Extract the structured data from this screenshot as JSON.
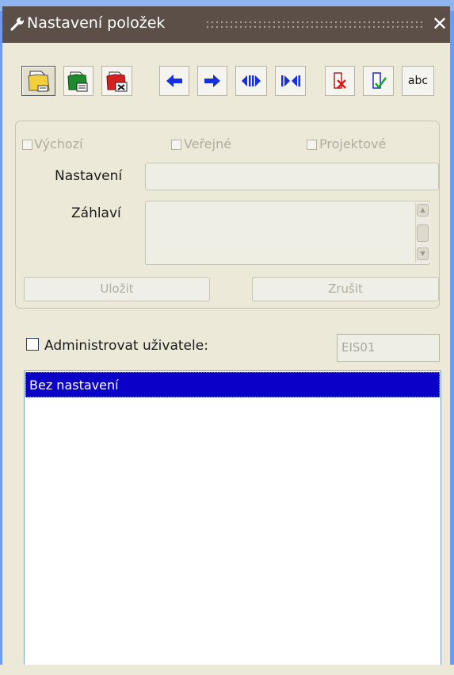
{
  "window": {
    "title": "Nastavení položek",
    "close_glyph": "✕"
  },
  "toolbar": {
    "buttons": [
      {
        "name": "new-setting-button",
        "icon": "folder-new-icon"
      },
      {
        "name": "copy-setting-button",
        "icon": "folder-copy-icon"
      },
      {
        "name": "delete-setting-button",
        "icon": "folder-delete-icon"
      },
      {
        "name": "move-left-button",
        "icon": "arrow-left-icon"
      },
      {
        "name": "move-right-button",
        "icon": "arrow-right-icon"
      },
      {
        "name": "expand-columns-button",
        "icon": "expand-icon"
      },
      {
        "name": "collapse-columns-button",
        "icon": "collapse-icon"
      },
      {
        "name": "remove-column-button",
        "icon": "remove-column-icon"
      },
      {
        "name": "check-column-button",
        "icon": "check-column-icon"
      },
      {
        "name": "text-format-button",
        "label": "abc"
      }
    ],
    "abc_label": "abc"
  },
  "settings_group": {
    "default_label": "Výchozí",
    "public_label": "Veřejné",
    "project_label": "Projektové",
    "setting_label": "Nastavení",
    "setting_value": "",
    "header_label": "Záhlaví",
    "header_value": "",
    "save_label": "Uložit",
    "cancel_label": "Zrušit"
  },
  "admin": {
    "checkbox_label": "Administrovat uživatele:",
    "checked": false,
    "user_value": "EIS01"
  },
  "settings_list": {
    "items": [
      "Bez nastavení"
    ],
    "selected_index": 0
  },
  "colors": {
    "titlebar": "#5c4f47",
    "window": "#ece9d8",
    "selection": "#0a00c8",
    "desktop": "#6e9bf0",
    "toolbar_blue": "#1430e0"
  }
}
